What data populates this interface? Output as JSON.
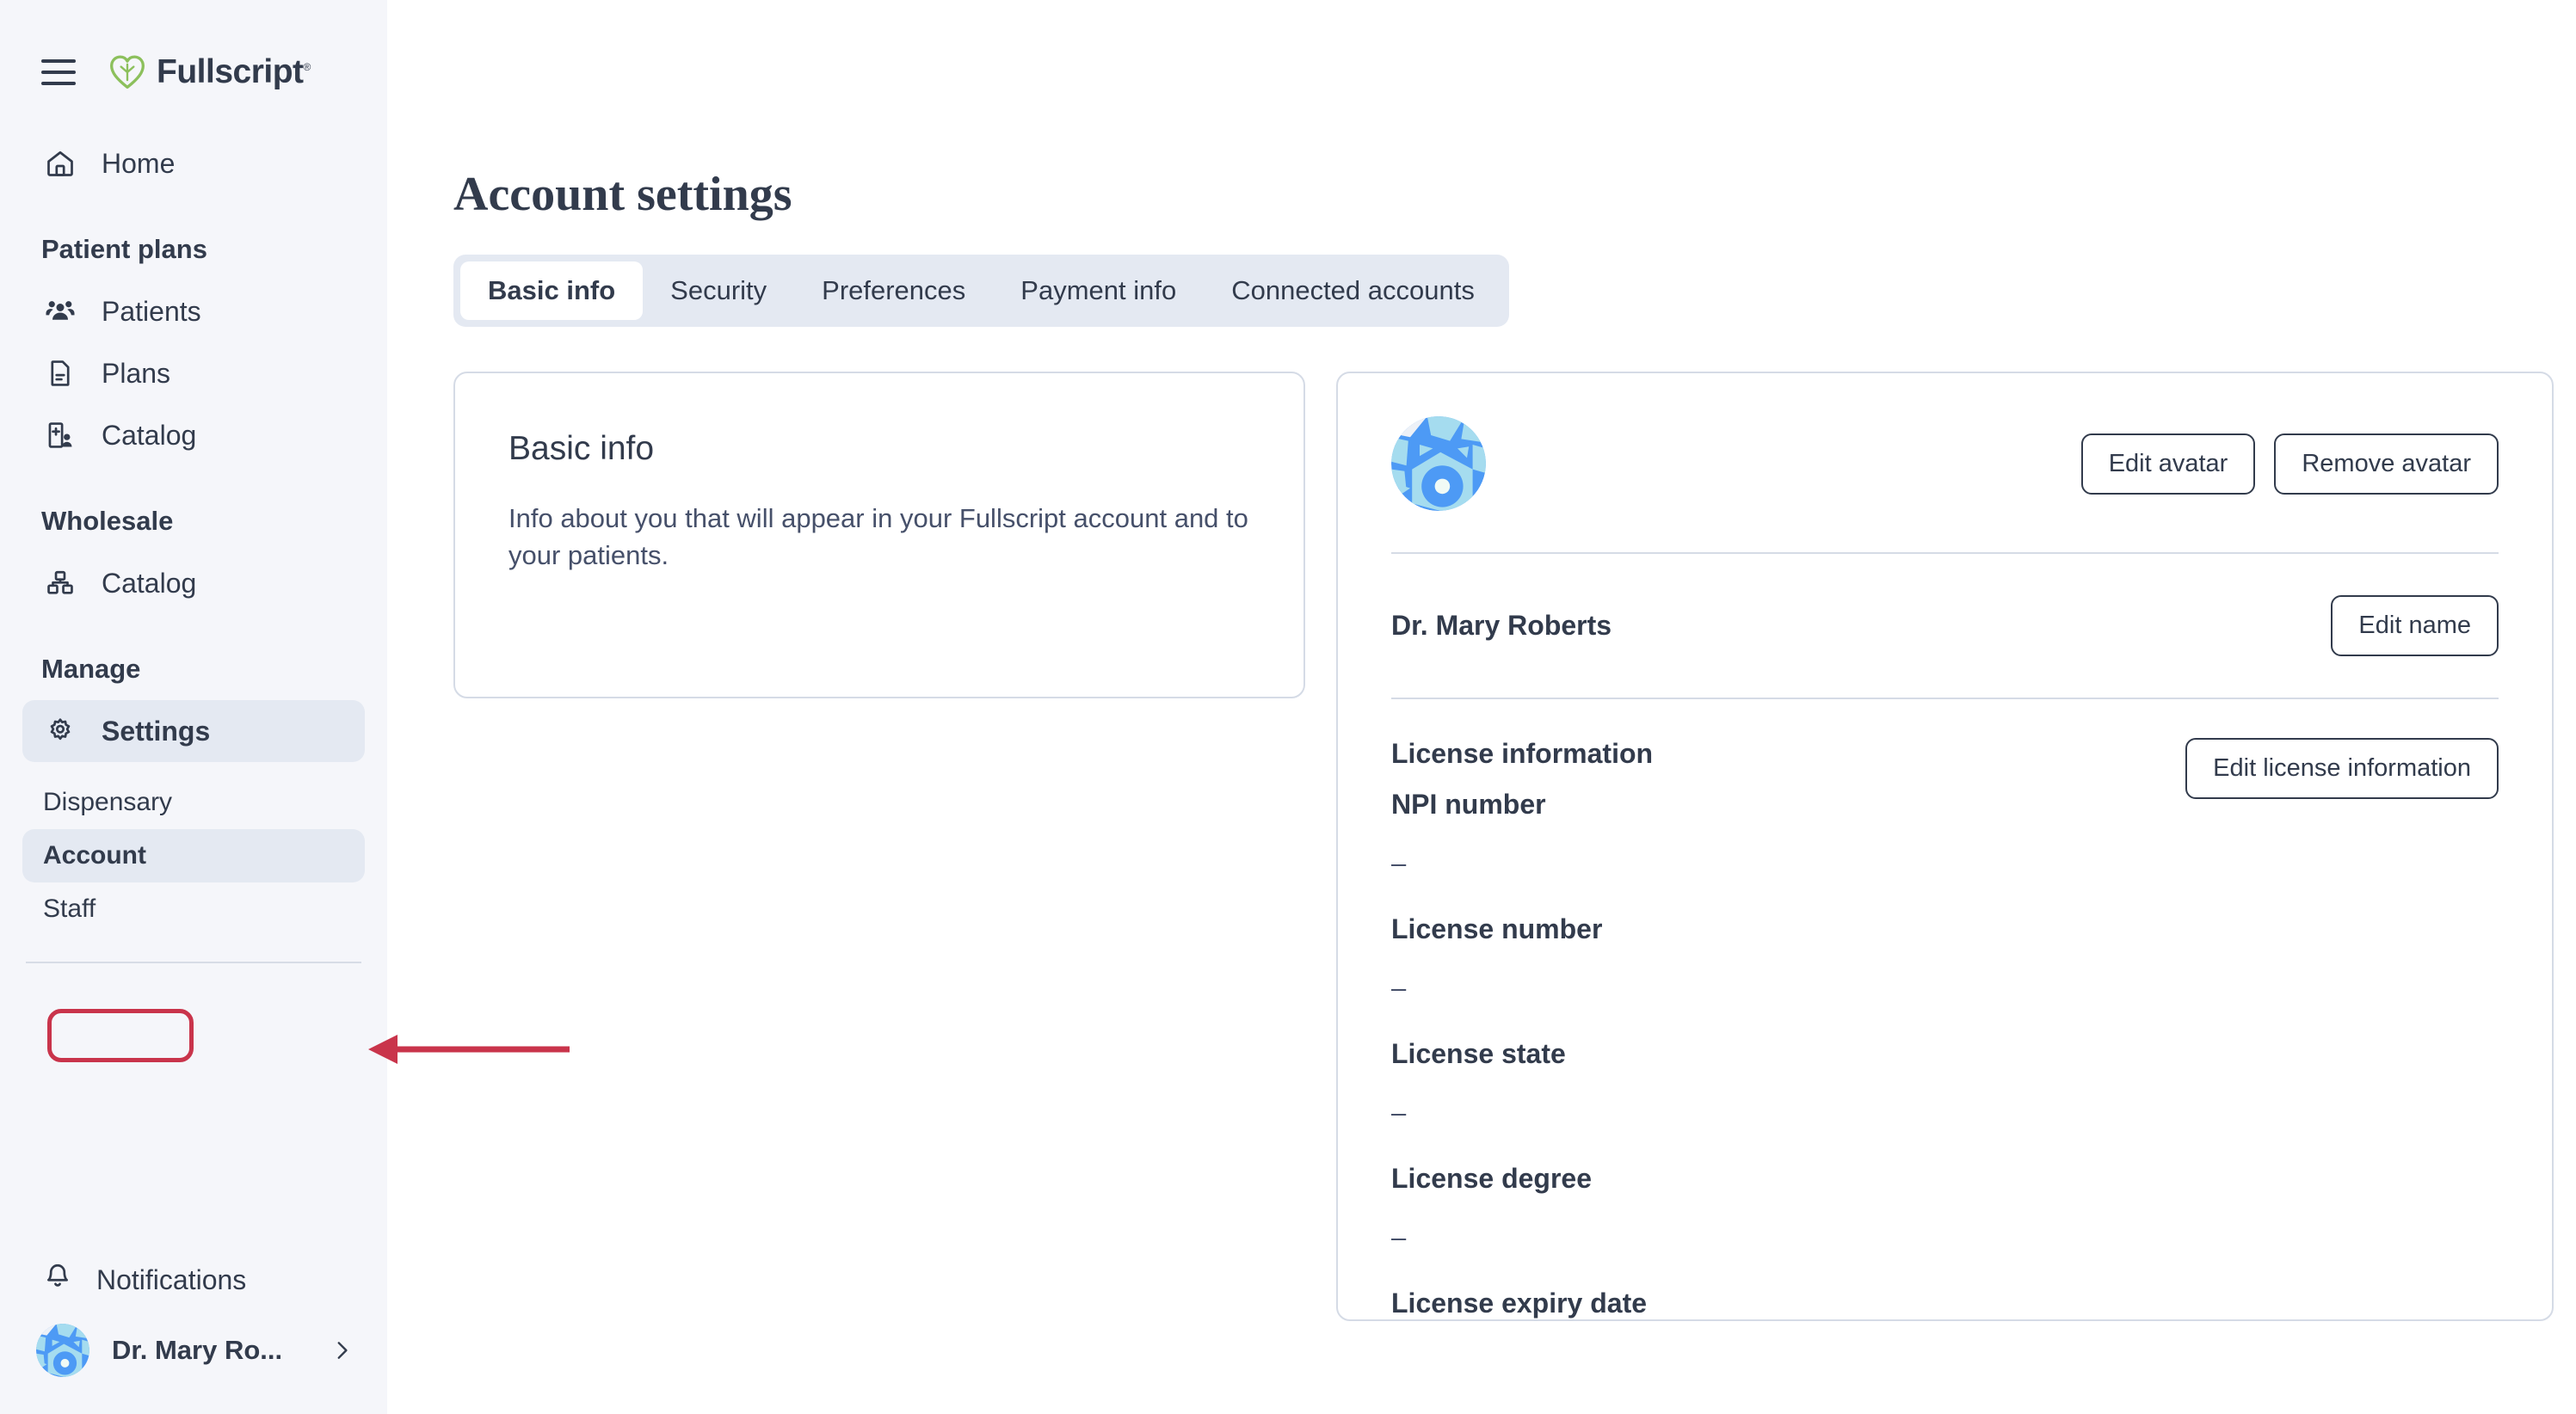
{
  "brand": {
    "logo_text": "Fullscript",
    "logo_trademark": "®",
    "leaf_color": "#8CC05C",
    "text_color": "#323B4C"
  },
  "sidebar": {
    "menu_icon": "hamburger-menu-icon",
    "primary": [
      {
        "label": "Home",
        "icon": "home-icon",
        "active": false
      }
    ],
    "sections": [
      {
        "heading": "Patient plans",
        "items": [
          {
            "label": "Patients",
            "icon": "patients-icon"
          },
          {
            "label": "Plans",
            "icon": "document-icon"
          },
          {
            "label": "Catalog",
            "icon": "catalog-icon"
          }
        ]
      },
      {
        "heading": "Wholesale",
        "items": [
          {
            "label": "Catalog",
            "icon": "wholesale-catalog-icon"
          }
        ]
      },
      {
        "heading": "Manage",
        "items": [
          {
            "label": "Settings",
            "icon": "gear-icon",
            "active": true
          }
        ],
        "subitems": [
          {
            "label": "Dispensary",
            "selected": false
          },
          {
            "label": "Account",
            "selected": true
          },
          {
            "label": "Staff",
            "selected": false
          }
        ]
      }
    ],
    "notifications": {
      "label": "Notifications",
      "icon": "bell-icon"
    },
    "profile": {
      "name": "Dr. Mary Ro...",
      "avatar": "user-avatar",
      "chevron": "chevron-right-icon"
    }
  },
  "main": {
    "page_title": "Account settings",
    "tabs": [
      {
        "label": "Basic info",
        "active": true
      },
      {
        "label": "Security",
        "active": false
      },
      {
        "label": "Preferences",
        "active": false
      },
      {
        "label": "Payment info",
        "active": false
      },
      {
        "label": "Connected accounts",
        "active": false
      }
    ],
    "info_card": {
      "title": "Basic info",
      "description": "Info about you that will appear in your Fullscript account and to your patients."
    },
    "profile_card": {
      "avatar": "user-avatar",
      "edit_avatar_label": "Edit avatar",
      "remove_avatar_label": "Remove avatar",
      "name": "Dr. Mary Roberts",
      "edit_name_label": "Edit name",
      "license_section_title": "License information",
      "edit_license_label": "Edit license information",
      "fields": [
        {
          "label": "NPI number",
          "value": "–"
        },
        {
          "label": "License number",
          "value": "–"
        },
        {
          "label": "License state",
          "value": "–"
        },
        {
          "label": "License degree",
          "value": "–"
        },
        {
          "label": "License expiry date",
          "value": ""
        }
      ]
    }
  },
  "annotation": {
    "color": "#C9344B",
    "highlight_target": "Account",
    "arrow_direction": "left"
  },
  "colors": {
    "sidebar_bg": "#F5F6FA",
    "main_bg": "#FFFFFF",
    "active_nav_bg": "#E4E9F2",
    "text": "#323B4C",
    "border": "#D5DBE6",
    "avatar_light": "#A5DCEF",
    "avatar_blue": "#4D9AF5"
  }
}
